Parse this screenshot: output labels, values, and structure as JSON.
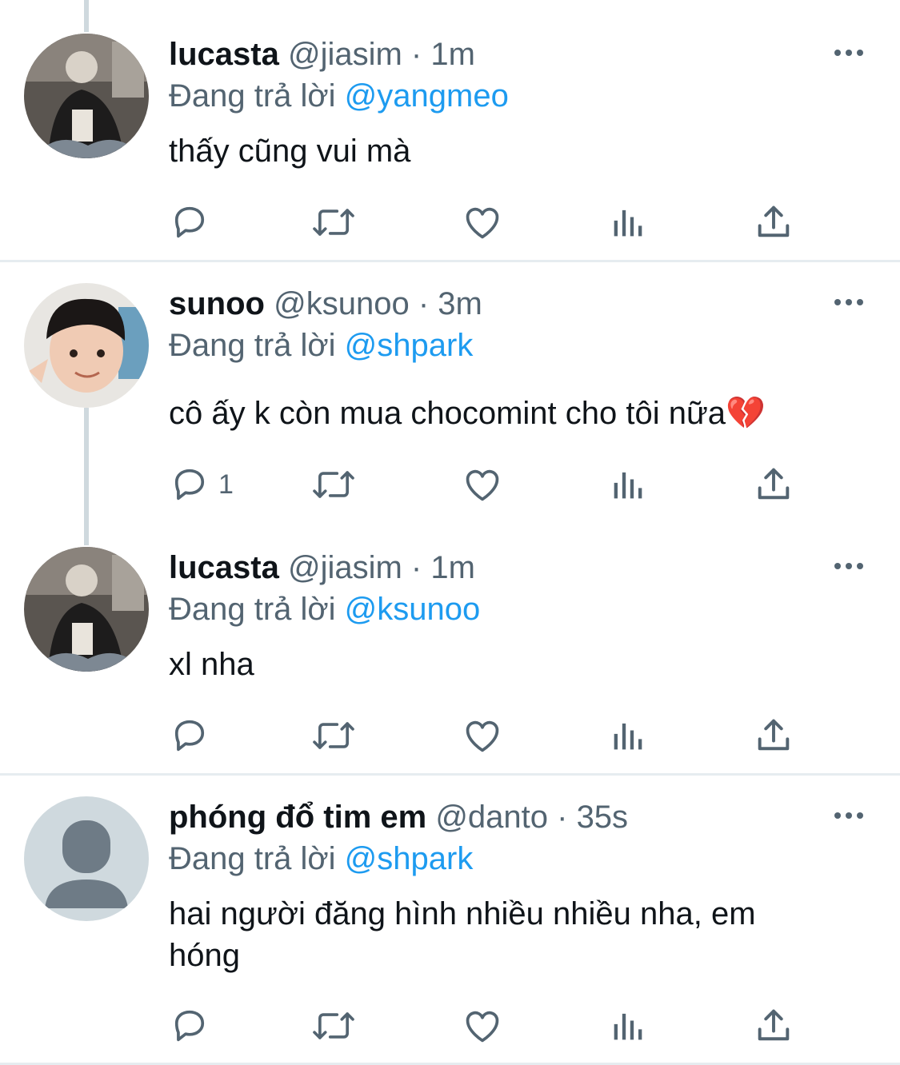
{
  "tweets": [
    {
      "name": "lucasta",
      "meta": "@jiasim · 1m",
      "reply_prefix": "Đang trả lời",
      "reply_to": "@yangmeo",
      "text": "thấy cũng vui mà",
      "reply_count": ""
    },
    {
      "name": "sunoo",
      "meta": "@ksunoo · 3m",
      "reply_prefix": "Đang trả lời",
      "reply_to": "@shpark",
      "text": "cô ấy k còn mua chocomint cho tôi nữa💔",
      "reply_count": "1"
    },
    {
      "name": "lucasta",
      "meta": "@jiasim · 1m",
      "reply_prefix": "Đang trả lời",
      "reply_to": "@ksunoo",
      "text": "xl nha",
      "reply_count": ""
    },
    {
      "name": "phóng đổ tim em",
      "meta": "@danto · 35s",
      "reply_prefix": "Đang trả lời",
      "reply_to": "@shpark",
      "text": "hai người đăng hình nhiều nhiều nha, em hóng",
      "reply_count": ""
    }
  ],
  "colors": {
    "text": "#0f1419",
    "secondary": "#536471",
    "link": "#1d9bf0",
    "thread_line": "#cfd9de",
    "divider": "#e6ecf0"
  },
  "icons": [
    "more-icon",
    "reply-icon",
    "retweet-icon",
    "like-icon",
    "views-icon",
    "share-icon"
  ]
}
